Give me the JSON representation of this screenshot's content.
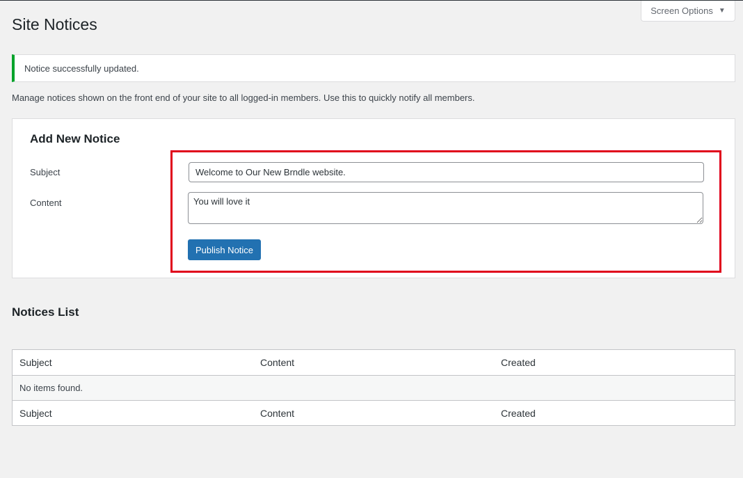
{
  "header": {
    "screen_options_label": "Screen Options",
    "page_title": "Site Notices"
  },
  "notice": {
    "message": "Notice successfully updated.",
    "color": "#00a32a"
  },
  "description": "Manage notices shown on the front end of your site to all logged-in members. Use this to quickly notify all members.",
  "add_notice": {
    "title": "Add New Notice",
    "subject_label": "Subject",
    "subject_value": "Welcome to Our New Brndle website.",
    "content_label": "Content",
    "content_value": "You will love it",
    "publish_label": "Publish Notice",
    "accent_color": "#2271b1",
    "highlight_color": "#e0001b"
  },
  "notices_list": {
    "title": "Notices List",
    "columns": [
      "Subject",
      "Content",
      "Created"
    ],
    "empty_message": "No items found.",
    "footer_columns": [
      "Subject",
      "Content",
      "Created"
    ]
  }
}
